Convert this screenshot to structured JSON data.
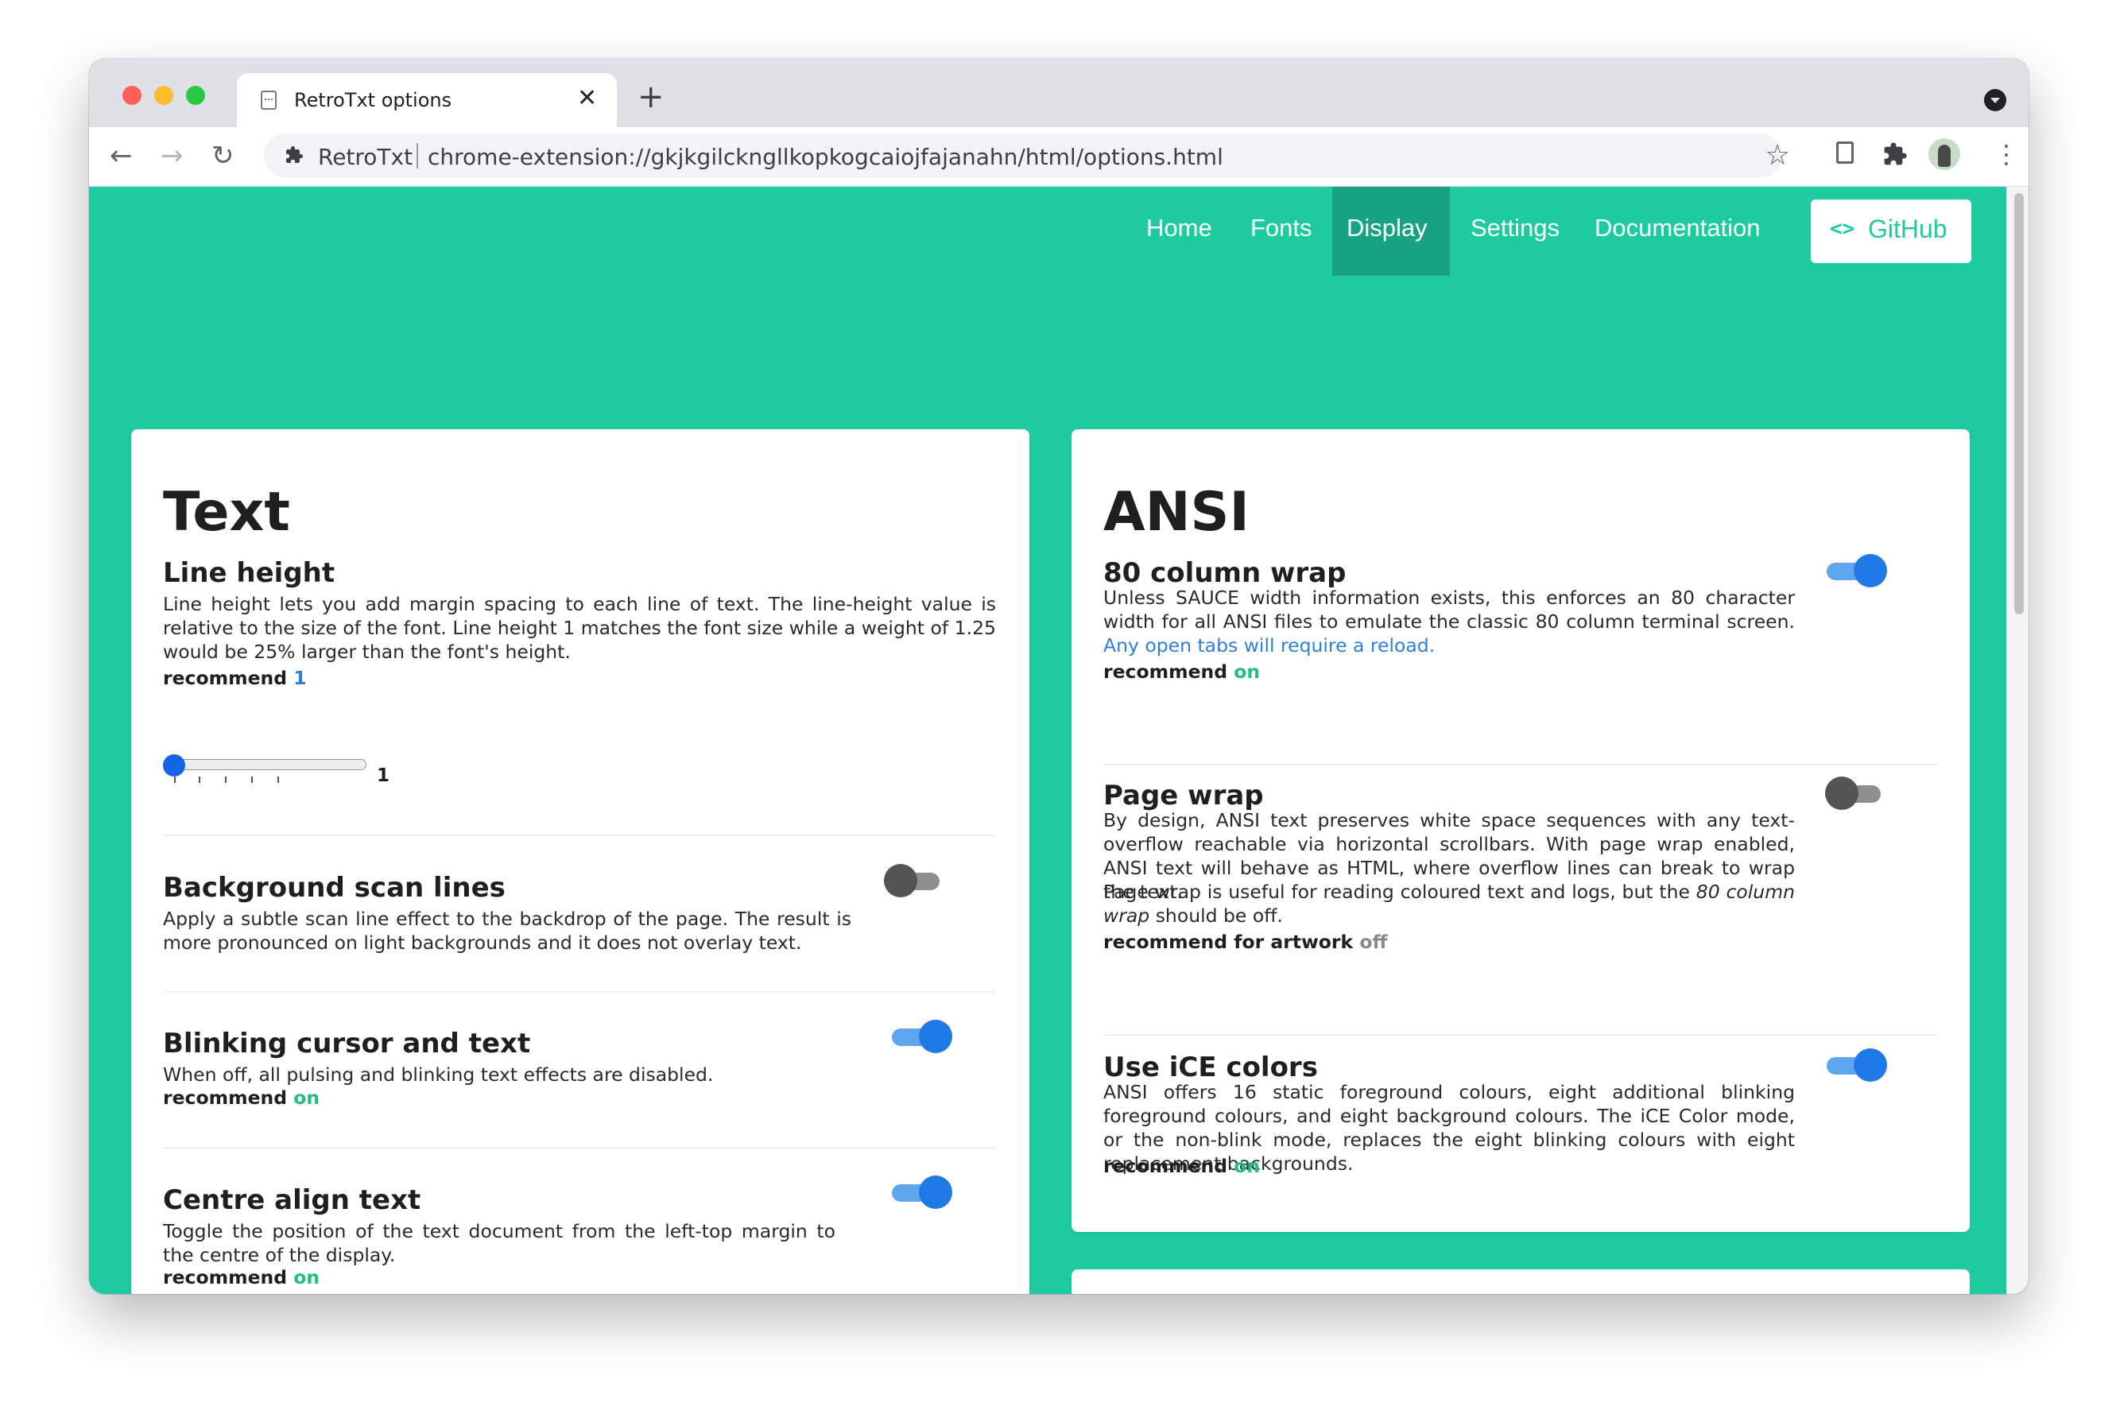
{
  "browser": {
    "tab_title": "RetroTxt options",
    "tab_close": "✕",
    "new_tab": "+",
    "extension_name": "RetroTxt",
    "url": "chrome-extension://gkjkgilckngllkopkogcaiojfajanahn/html/options.html",
    "icons": {
      "back": "arrow-left-icon",
      "forward": "arrow-right-icon",
      "reload": "reload-icon",
      "bookmark": "star-icon",
      "extensions": "puzzle-icon",
      "menu": "more-vertical-icon"
    },
    "glyphs": {
      "back": "←",
      "forward": "→",
      "reload": "↻",
      "star": "☆",
      "more": "⋮"
    }
  },
  "site_nav": {
    "items": [
      "Home",
      "Fonts",
      "Display",
      "Settings",
      "Documentation"
    ],
    "active": "Display",
    "github_icon": "<>",
    "github_label": "GitHub"
  },
  "colors": {
    "brand": "#1ecba0",
    "nav_active": "#17a383",
    "toggle_on": "#1f7ae8",
    "recommend_on": "#23c07a",
    "link": "#2d7fde"
  },
  "text_card": {
    "title": "Text",
    "line_height": {
      "title": "Line height",
      "description": "Line height lets you add margin spacing to each line of text. The line-height value is relative to the size of the font. Line height 1 matches the font size while a weight of 1.25 would be 25% larger than the font's height.",
      "recommend_label": "recommend",
      "recommend_value": "1",
      "slider_value": "1"
    },
    "scan_lines": {
      "title": "Background scan lines",
      "description": "Apply a subtle scan line effect to the backdrop of the page. The result is more pronounced on light backgrounds and it does not overlay text.",
      "enabled": false
    },
    "blinking": {
      "title": "Blinking cursor and text",
      "description": "When off, all pulsing and blinking text effects are disabled.",
      "recommend_label": "recommend",
      "recommend_value": "on",
      "enabled": true
    },
    "centre_align": {
      "title": "Centre align text",
      "description": "Toggle the position of the text document from the left-top margin to the centre of the display.",
      "recommend_label": "recommend",
      "recommend_value": "on",
      "enabled": true
    }
  },
  "ansi_card": {
    "title": "ANSI",
    "column_wrap": {
      "title": "80 column wrap",
      "description": "Unless SAUCE width information exists, this enforces an 80 character width for all ANSI files to emulate the classic 80 column terminal screen.",
      "note": "Any open tabs will require a reload.",
      "recommend_label": "recommend",
      "recommend_value": "on",
      "enabled": true
    },
    "page_wrap": {
      "title": "Page wrap",
      "description": "By design, ANSI text preserves white space sequences with any text-overflow reachable via horizontal scrollbars. With page wrap enabled, ANSI text will behave as HTML, where overflow lines can break to wrap the text.",
      "description2_start": "Page wrap is useful for reading coloured text and logs, but the",
      "description2_em": "80 column wrap",
      "description2_end": "should be off.",
      "recommend_label": "recommend for artwork",
      "recommend_value": "off",
      "enabled": false
    },
    "ice_colors": {
      "title": "Use iCE colors",
      "description": "ANSI offers 16 static foreground colours, eight additional blinking foreground colours, and eight background colours. The iCE Color mode, or the non-blink mode, replaces the eight blinking colours with eight replacement backgrounds.",
      "recommend_label": "recommend",
      "recommend_value": "on",
      "enabled": true
    }
  }
}
